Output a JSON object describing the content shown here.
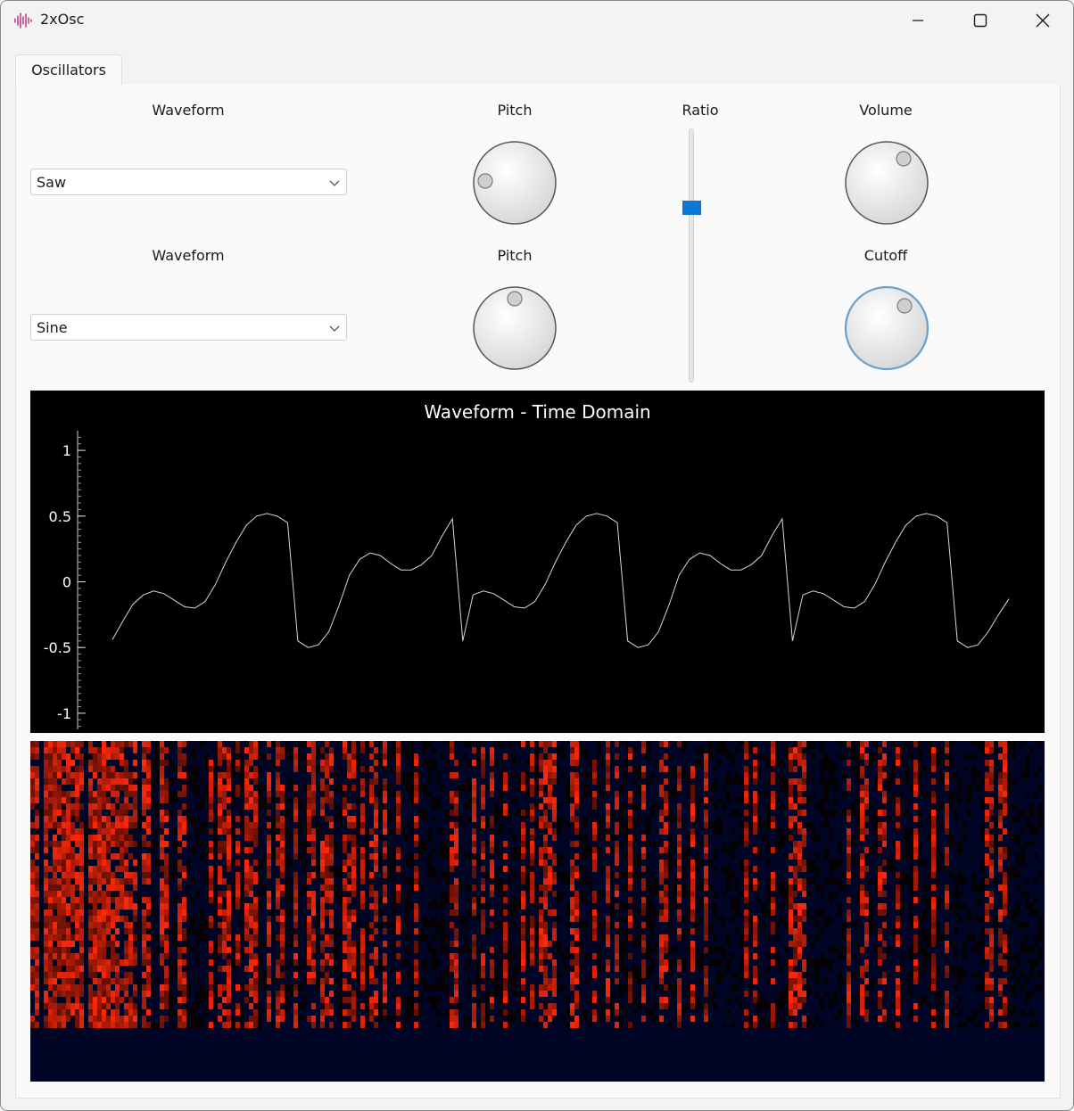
{
  "window": {
    "title": "2xOsc",
    "controls": [
      "minimize-icon",
      "maximize-icon",
      "close-icon"
    ]
  },
  "tabs": [
    {
      "label": "Oscillators",
      "selected": true
    }
  ],
  "osc1": {
    "waveform_label": "Waveform",
    "waveform_value": "Saw",
    "pitch_label": "Pitch"
  },
  "osc2": {
    "waveform_label": "Waveform",
    "waveform_value": "Sine",
    "pitch_label": "Pitch"
  },
  "ratio": {
    "label": "Ratio",
    "value": 0.7
  },
  "volume": {
    "label": "Volume"
  },
  "cutoff": {
    "label": "Cutoff"
  },
  "colors": {
    "accent": "#0a78d4",
    "plot_bg": "#000000",
    "spectrogram_bg": "#000525",
    "spectrogram_hot": "#ff2a0a"
  },
  "chart_data": {
    "type": "line",
    "title": "Waveform - Time Domain",
    "ylim": [
      -1.15,
      1.15
    ],
    "yticks": [
      1,
      0.5,
      0,
      -0.5,
      -1
    ],
    "ytick_labels": [
      "1",
      "0.5",
      "0",
      "-0.5",
      "-1"
    ],
    "series": [
      {
        "y": [
          -0.44,
          -0.3,
          -0.17,
          -0.1,
          -0.07,
          -0.09,
          -0.14,
          -0.19,
          -0.2,
          -0.15,
          -0.02,
          0.15,
          0.3,
          0.43,
          0.5,
          0.52,
          0.5,
          0.45,
          -0.45,
          -0.5,
          -0.48,
          -0.38,
          -0.18,
          0.05,
          0.17,
          0.22,
          0.2,
          0.14,
          0.09,
          0.09,
          0.13,
          0.2,
          0.35,
          0.48,
          -0.45,
          -0.1,
          -0.07,
          -0.09,
          -0.14,
          -0.19,
          -0.2,
          -0.15,
          -0.02,
          0.15,
          0.3,
          0.43,
          0.5,
          0.52,
          0.5,
          0.45,
          -0.45,
          -0.5,
          -0.48,
          -0.38,
          -0.18,
          0.05,
          0.17,
          0.22,
          0.2,
          0.14,
          0.09,
          0.09,
          0.13,
          0.2,
          0.35,
          0.48,
          -0.45,
          -0.1,
          -0.07,
          -0.09,
          -0.14,
          -0.19,
          -0.2,
          -0.15,
          -0.02,
          0.15,
          0.3,
          0.43,
          0.5,
          0.52,
          0.5,
          0.45,
          -0.45,
          -0.5,
          -0.48,
          -0.38,
          -0.25,
          -0.13
        ]
      }
    ]
  }
}
